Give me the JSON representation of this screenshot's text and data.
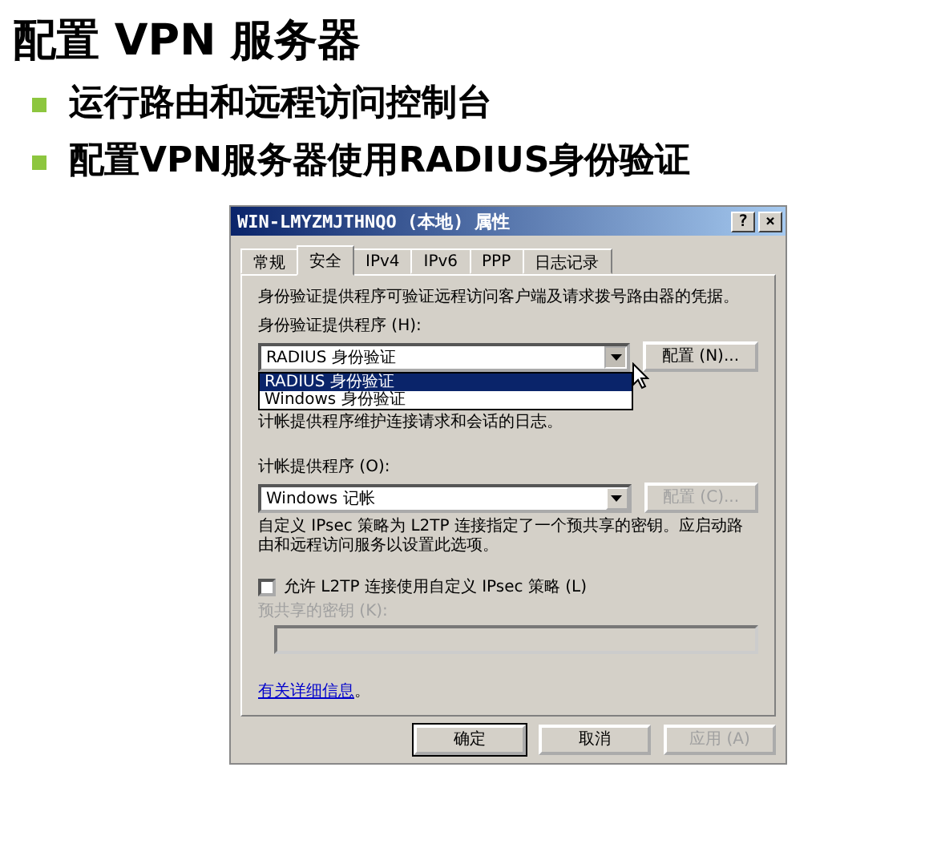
{
  "slide": {
    "title": "配置 VPN 服务器",
    "bullets": [
      "运行路由和远程访问控制台",
      "配置VPN服务器使用RADIUS身份验证"
    ]
  },
  "dialog": {
    "title": "WIN-LMYZMJTHNQO (本地) 属性",
    "help_button": "?",
    "close_button": "×",
    "tabs": [
      {
        "label": "常规",
        "selected": false
      },
      {
        "label": "安全",
        "selected": true
      },
      {
        "label": "IPv4",
        "selected": false
      },
      {
        "label": "IPv6",
        "selected": false
      },
      {
        "label": "PPP",
        "selected": false
      },
      {
        "label": "日志记录",
        "selected": false
      }
    ],
    "auth_description": "身份验证提供程序可验证远程访问客户端及请求拨号路由器的凭据。",
    "auth_label": "身份验证提供程序 (H):",
    "auth_combo": {
      "value": "RADIUS 身份验证",
      "expanded": true,
      "options": [
        {
          "label": "RADIUS 身份验证",
          "selected": true
        },
        {
          "label": "Windows 身份验证",
          "selected": false
        }
      ]
    },
    "auth_config_button": {
      "label": "配置 (N)...",
      "disabled": false
    },
    "accounting_description": "计帐提供程序维护连接请求和会话的日志。",
    "accounting_label": "计帐提供程序 (O):",
    "accounting_combo": {
      "value": "Windows 记帐",
      "expanded": false
    },
    "accounting_config_button": {
      "label": "配置 (C)...",
      "disabled": true
    },
    "ipsec_note": "自定义 IPsec 策略为 L2TP 连接指定了一个预共享的密钥。应启动路由和远程访问服务以设置此选项。",
    "ipsec_checkbox": {
      "label": "允许 L2TP 连接使用自定义 IPsec 策略 (L)",
      "checked": false
    },
    "psk_label": "预共享的密钥 (K):",
    "psk_field": {
      "disabled": true
    },
    "more_info_link": "有关详细信息",
    "more_info_suffix": "。",
    "buttons": [
      {
        "label": "确定",
        "disabled": false,
        "default": true
      },
      {
        "label": "取消",
        "disabled": false,
        "default": false
      },
      {
        "label": "应用 (A)",
        "disabled": true,
        "default": false
      }
    ]
  }
}
